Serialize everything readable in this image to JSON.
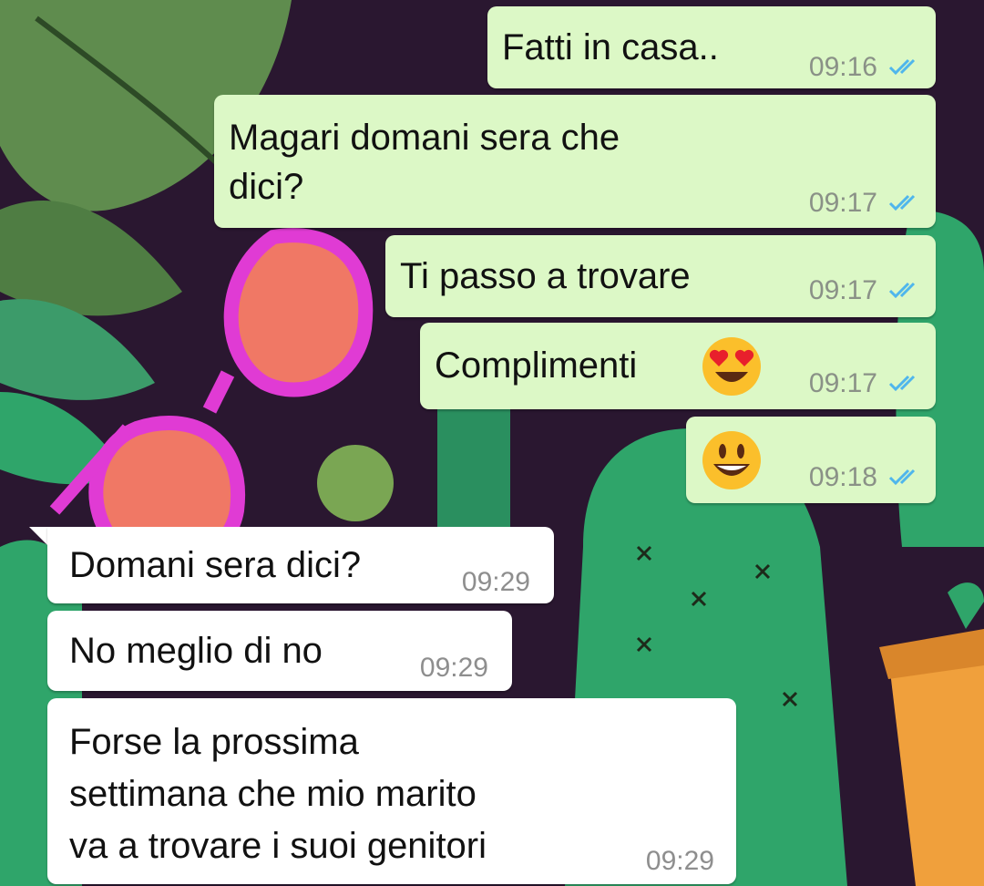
{
  "wallpaper": {
    "description_icon": "doodle-wallpaper-cactus-sunglasses",
    "colors": {
      "bg": "#2a1730",
      "leaf": "#5f8c4e",
      "cactus": "#2fa56a",
      "glasses": "#e03bd4",
      "lens": "#f07865",
      "pot": "#f0a03c"
    }
  },
  "chat": {
    "messages": [
      {
        "direction": "outgoing",
        "text": "Fatti in casa..",
        "time": "09:16",
        "status": "read-ticks-icon"
      },
      {
        "direction": "outgoing",
        "text": "Magari domani sera che\ndici?",
        "time": "09:17",
        "status": "read-ticks-icon"
      },
      {
        "direction": "outgoing",
        "text": "Ti passo a trovare",
        "time": "09:17",
        "status": "read-ticks-icon"
      },
      {
        "direction": "outgoing",
        "text": "Complimenti",
        "emoji": "heart-eyes-emoji-icon",
        "time": "09:17",
        "status": "read-ticks-icon"
      },
      {
        "direction": "outgoing",
        "text": "",
        "emoji": "grinning-emoji-icon",
        "time": "09:18",
        "status": "read-ticks-icon"
      },
      {
        "direction": "incoming",
        "text": "Domani sera dici?",
        "time": "09:29"
      },
      {
        "direction": "incoming",
        "text": "No meglio di no",
        "time": "09:29"
      },
      {
        "direction": "incoming",
        "text": "Forse la prossima\nsettimana che mio marito\nva a trovare i suoi genitori",
        "time": "09:29"
      }
    ]
  },
  "colors": {
    "outgoing_bubble": "#dcf8c6",
    "incoming_bubble": "#ffffff",
    "read_ticks": "#4fb6ec"
  }
}
